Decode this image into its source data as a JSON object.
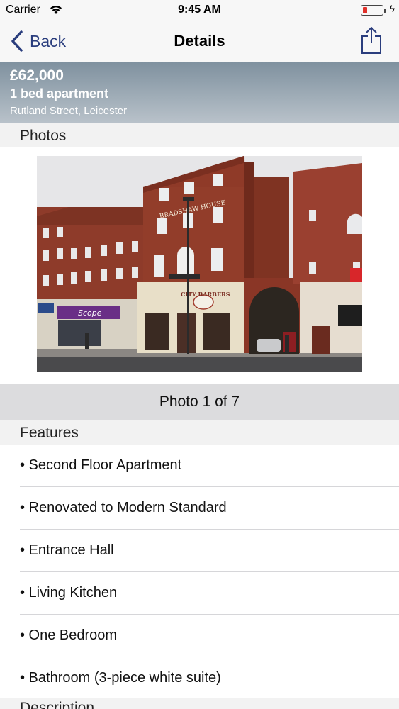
{
  "status_bar": {
    "carrier": "Carrier",
    "time": "9:45 AM",
    "battery_level": 0.2,
    "battery_color": "#e0312a"
  },
  "nav": {
    "back_label": "Back",
    "title": "Details",
    "share_icon": "share-icon",
    "tint": "#2a3d7d"
  },
  "banner": {
    "price": "£62,000",
    "type": "1 bed apartment",
    "address": "Rutland Street, Leicester"
  },
  "photos": {
    "header": "Photos",
    "caption": "Photo 1 of 7",
    "signs": {
      "building_name": "BRADSHAW HOUSE",
      "shop_left": "Scope",
      "shop_middle": "CITY BARBERS"
    }
  },
  "features": {
    "header": "Features",
    "items": [
      "• Second Floor Apartment",
      "• Renovated to Modern Standard",
      "• Entrance Hall",
      "• Living Kitchen",
      "• One Bedroom",
      "• Bathroom (3-piece white suite)"
    ]
  },
  "description": {
    "header": "Description"
  }
}
